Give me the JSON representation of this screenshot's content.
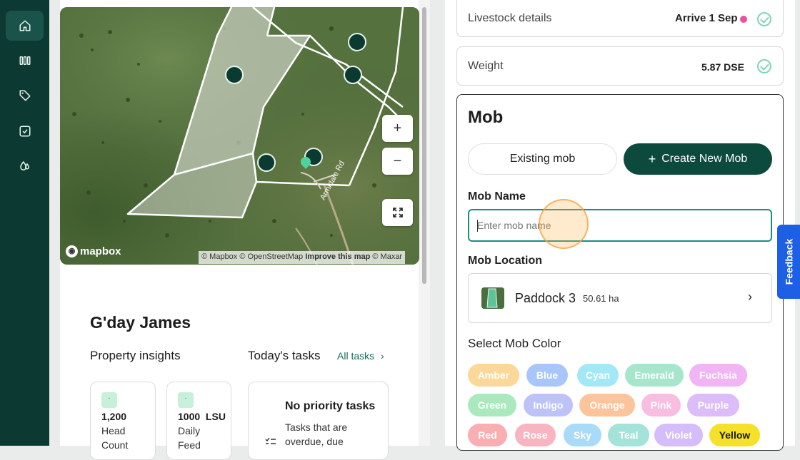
{
  "sidebar": {
    "items": [
      {
        "icon": "home-icon"
      },
      {
        "icon": "grid-icon"
      },
      {
        "icon": "tag-icon"
      },
      {
        "icon": "tasks-icon"
      },
      {
        "icon": "drops-icon"
      }
    ]
  },
  "map": {
    "logo": "mapbox",
    "attribution_1": "© Mapbox © OpenStreetMap",
    "attribution_2": "Improve this map",
    "attribution_3": "© Maxar",
    "road_label": "Armidale Rd",
    "zoom_in": "+",
    "zoom_out": "−"
  },
  "home": {
    "greeting": "G'day James",
    "property_insights": "Property insights",
    "todays_tasks": "Today's tasks",
    "all_tasks": "All tasks",
    "stats": [
      {
        "badge": "·",
        "value": "1,200",
        "label_1": "Head",
        "label_2": "Count"
      },
      {
        "badge": "·",
        "value": "1000  LSU",
        "label_1": "Daily",
        "label_2": "Feed"
      }
    ],
    "no_tasks_title": "No priority tasks",
    "no_tasks_line1": "Tasks that are",
    "no_tasks_line2": "overdue, due"
  },
  "form": {
    "livestock_label": "Livestock details",
    "livestock_value": "Arrive 1 Sep",
    "weight_label": "Weight",
    "weight_value": "5.87 DSE",
    "mob_title": "Mob",
    "existing_mob": "Existing mob",
    "create_mob": "Create New Mob",
    "mob_name_label": "Mob Name",
    "mob_name_placeholder": "Enter mob name",
    "mob_location_label": "Mob Location",
    "paddock_name": "Paddock 3",
    "paddock_area": "50.61 ha",
    "select_color_label": "Select Mob Color",
    "colors": [
      {
        "name": "Amber",
        "hex": "#fcd79a"
      },
      {
        "name": "Blue",
        "hex": "#a9c6fb"
      },
      {
        "name": "Cyan",
        "hex": "#a3e8f7"
      },
      {
        "name": "Emerald",
        "hex": "#a7e6cd"
      },
      {
        "name": "Fuchsia",
        "hex": "#f1b4f5"
      },
      {
        "name": "Green",
        "hex": "#a9e9bd"
      },
      {
        "name": "Indigo",
        "hex": "#bdc2f9"
      },
      {
        "name": "Orange",
        "hex": "#fbc49a"
      },
      {
        "name": "Pink",
        "hex": "#f8bde0"
      },
      {
        "name": "Purple",
        "hex": "#dcbdf9"
      },
      {
        "name": "Red",
        "hex": "#f9aeb1"
      },
      {
        "name": "Rose",
        "hex": "#f9b4c1"
      },
      {
        "name": "Sky",
        "hex": "#a9dbf8"
      },
      {
        "name": "Teal",
        "hex": "#a3e3d9"
      },
      {
        "name": "Violet",
        "hex": "#d4bdfa"
      },
      {
        "name": "Yellow",
        "hex": "#f5e12a"
      }
    ]
  },
  "feedback": "Feedback",
  "colors": {
    "brand": "#0c4a3e",
    "sidebar": "#0c3a33",
    "accent": "#1d5fe5"
  }
}
